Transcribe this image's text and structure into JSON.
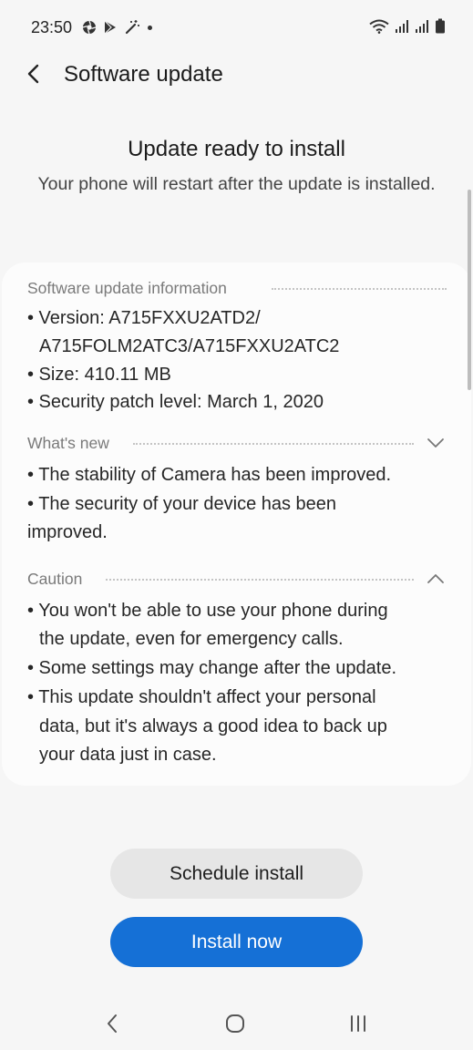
{
  "status_bar": {
    "time": "23:50",
    "left_icons": [
      "aperture-icon",
      "play-store-icon",
      "wand-icon",
      "dot-icon"
    ],
    "right_icons": [
      "wifi-icon",
      "signal-icon",
      "signal-icon",
      "battery-icon"
    ]
  },
  "header": {
    "title": "Software update"
  },
  "hero": {
    "title": "Update ready to install",
    "subtitle": "Your phone will restart after the update is installed."
  },
  "sections": {
    "info": {
      "label": "Software update information",
      "lines": [
        "• Version: A715FXXU2ATD2/",
        "A715FOLM2ATC3/A715FXXU2ATC2",
        "• Size: 410.11 MB",
        "• Security patch level: March 1, 2020"
      ]
    },
    "whats_new": {
      "label": "What's new",
      "expanded": false,
      "lines": [
        "• The stability of Camera has been improved.",
        "• The security of your device has been",
        "improved."
      ]
    },
    "caution": {
      "label": "Caution",
      "expanded": true,
      "lines": [
        "• You won't be able to use your phone during",
        "the update, even for emergency calls.",
        "• Some settings may change after the update.",
        "• This update shouldn't affect your personal",
        "data, but it's always a good idea to back up",
        "your data just in case."
      ]
    }
  },
  "buttons": {
    "schedule": "Schedule install",
    "install": "Install now"
  },
  "colors": {
    "background": "#f6f6f6",
    "card": "#fcfcfc",
    "primary": "#1570d6",
    "secondary_button": "#e6e6e6"
  }
}
